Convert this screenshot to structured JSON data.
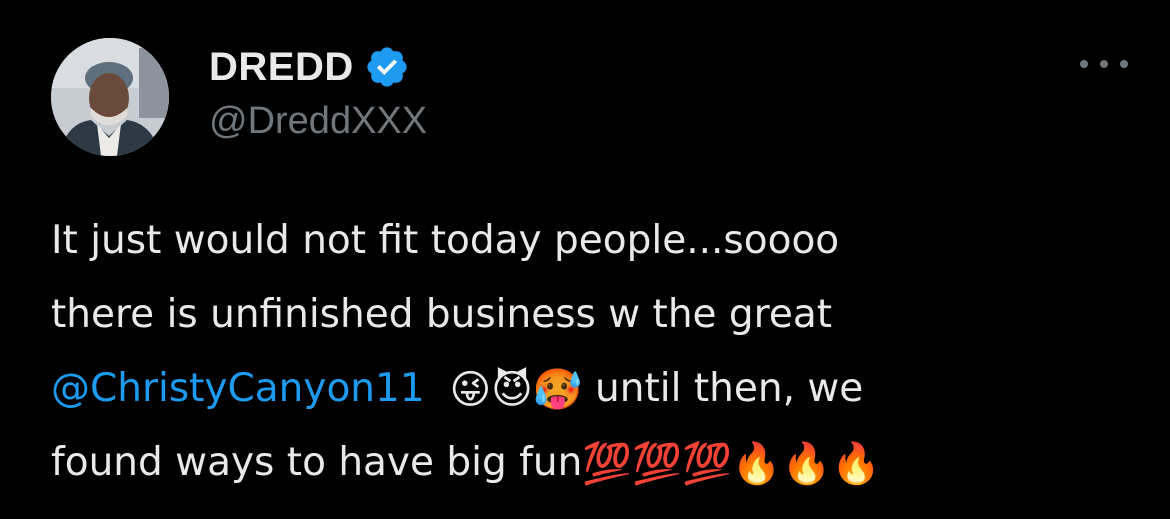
{
  "author": {
    "display_name": "DREDD",
    "handle": "@DreddXXX",
    "verified": true
  },
  "post": {
    "line1": "It just would not fit today people...soooo",
    "line2": "there is unfinished  business w the great",
    "mention": "@ChristyCanyon11",
    "emoji_group1": "😜😈🥵",
    "line3_rest": " until then, we",
    "line4_text": "found ways to have big fun",
    "emoji_group2": "💯💯💯🔥🔥🔥"
  },
  "icons": {
    "verified_badge": "verified-badge-icon",
    "more": "more-options-icon"
  },
  "colors": {
    "background": "#000000",
    "primary_text": "#e7e9ea",
    "secondary_text": "#71767b",
    "link": "#1d9bf0",
    "verified": "#1d9bf0"
  }
}
